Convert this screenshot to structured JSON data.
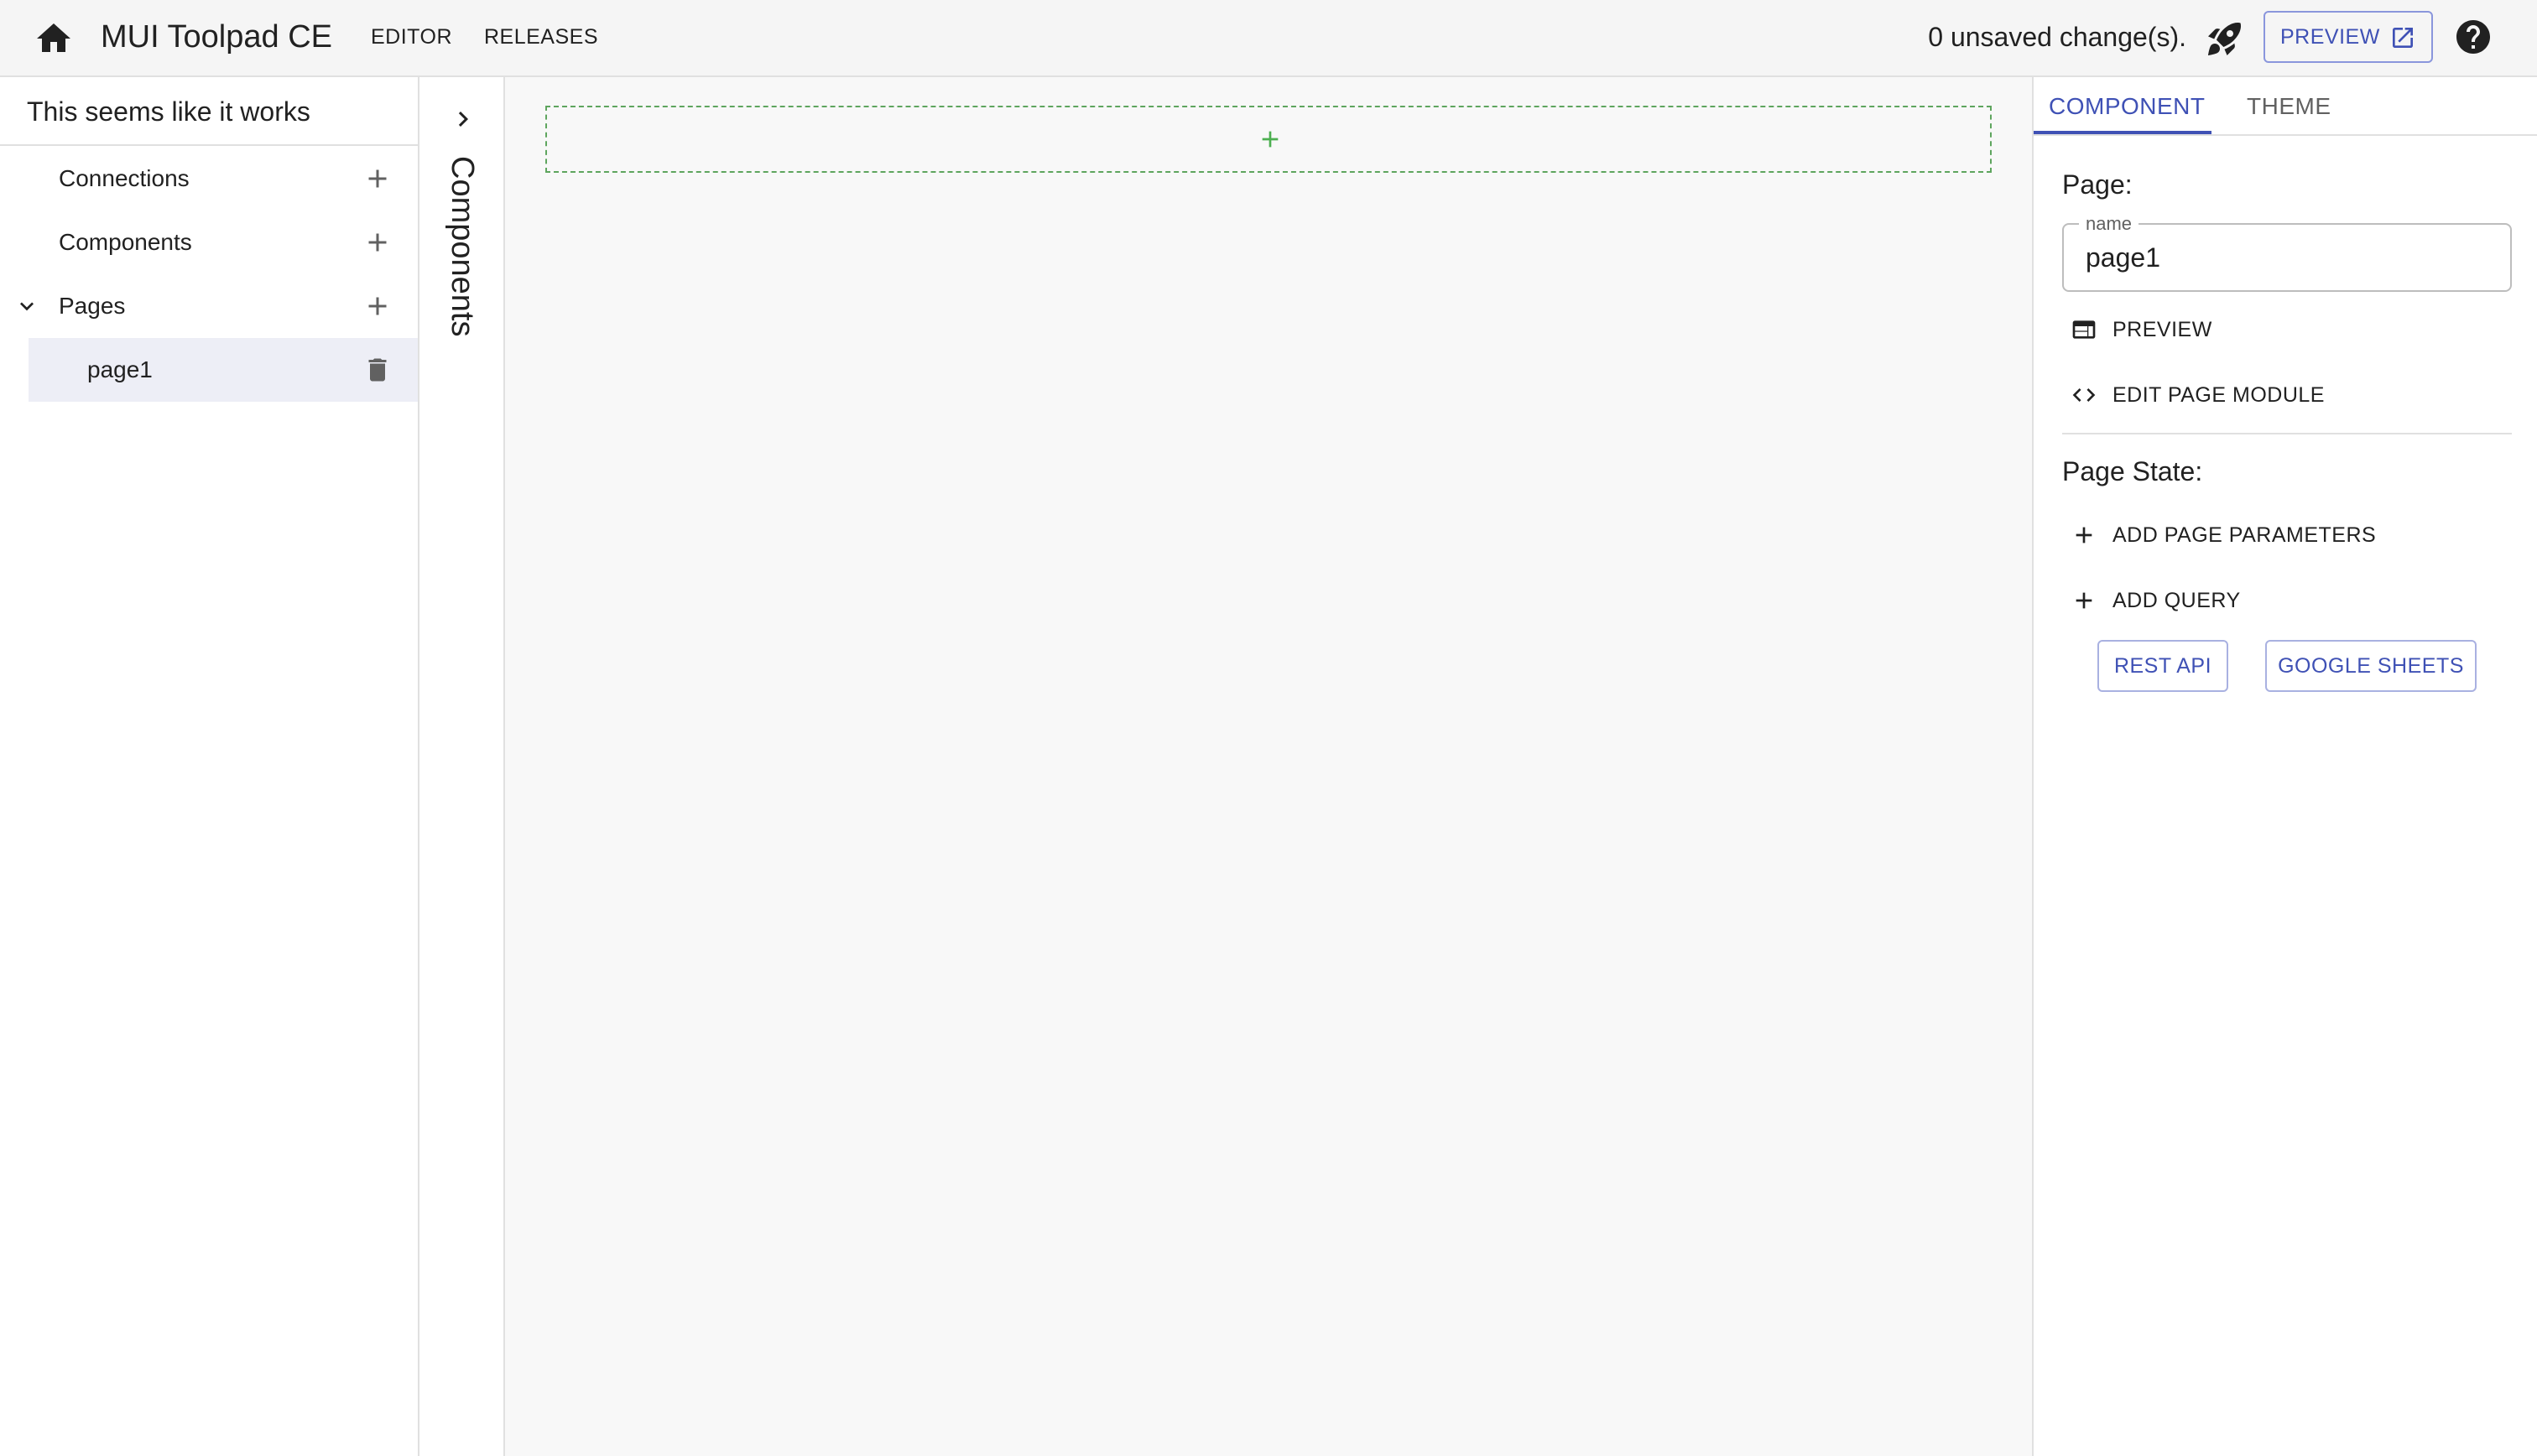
{
  "appbar": {
    "home_icon": "home-icon",
    "title": "MUI Toolpad CE",
    "nav": {
      "editor": "EDITOR",
      "releases": "RELEASES"
    },
    "unsaved_status": "0 unsaved change(s).",
    "deploy_icon": "rocket-icon",
    "preview_label": "PREVIEW",
    "preview_icon": "open-in-new-icon",
    "help_icon": "help-icon"
  },
  "sidebar": {
    "app_name": "This seems like it works",
    "items": [
      {
        "label": "Connections",
        "action_icon": "plus-icon"
      },
      {
        "label": "Components",
        "action_icon": "plus-icon"
      },
      {
        "label": "Pages",
        "action_icon": "plus-icon",
        "expanded": true
      },
      {
        "label": "page1",
        "action_icon": "delete-icon",
        "selected": true
      }
    ]
  },
  "components_panel": {
    "label": "Components",
    "expand_icon": "chevron-right-icon"
  },
  "canvas": {
    "drop_icon": "plus-icon"
  },
  "inspector": {
    "tabs": [
      {
        "label": "COMPONENT",
        "active": true
      },
      {
        "label": "THEME",
        "active": false
      }
    ],
    "page_label": "Page:",
    "name_field": {
      "legend": "name",
      "value": "page1"
    },
    "preview_action": "PREVIEW",
    "edit_module_action": "EDIT PAGE MODULE",
    "page_state_label": "Page State:",
    "add_params_action": "ADD PAGE PARAMETERS",
    "add_query_action": "ADD QUERY",
    "query_types": [
      "REST API",
      "GOOGLE SHEETS"
    ]
  },
  "colors": {
    "accent": "#3f51b5",
    "drop_zone": "#5ea55e",
    "selected_item": "#edeef6",
    "canvas_bg": "#f8f8f8"
  }
}
